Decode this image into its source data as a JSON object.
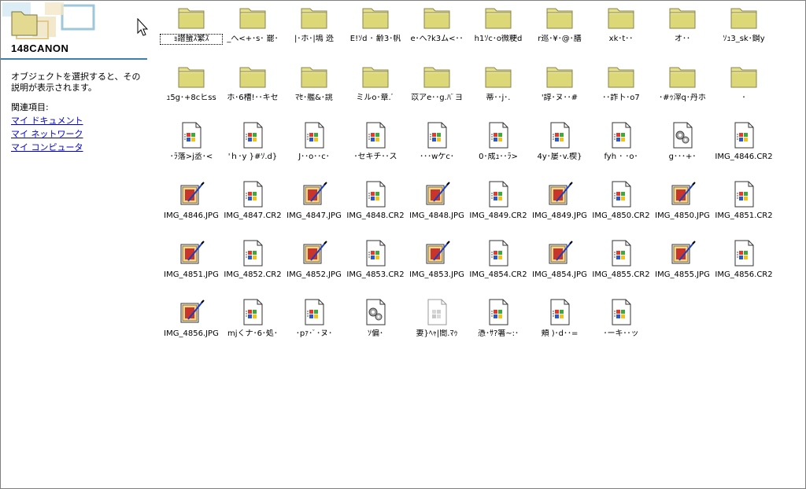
{
  "info_pane": {
    "folder_name": "148CANON",
    "description": "オブジェクトを選択すると、その説明が表示されます。",
    "related_heading": "関連項目:",
    "related_links": [
      "マイ ドキュメント",
      "マイ ネットワーク",
      "マイ コンピュータ"
    ]
  },
  "items": [
    {
      "label": "ｮ譛蜑ｽ繁ｽ",
      "icon": "folder-icon",
      "selected": true
    },
    {
      "label": "_へ<+･s･ 罷･",
      "icon": "folder-icon"
    },
    {
      "label": "|･ホ･|塢 迯",
      "icon": "folder-icon"
    },
    {
      "label": "E!ｿd ･ 齢3･帆",
      "icon": "folder-icon"
    },
    {
      "label": "e･へ?k3ム<･･",
      "icon": "folder-icon"
    },
    {
      "label": "h1ｿc･o微粳d",
      "icon": "folder-icon"
    },
    {
      "label": "r巡･¥･@･膳",
      "icon": "folder-icon"
    },
    {
      "label": "xk･t･･",
      "icon": "folder-icon"
    },
    {
      "label": "オ･･",
      "icon": "folder-icon"
    },
    {
      "label": "ｿｭ3_sk･鋼y",
      "icon": "folder-icon"
    },
    {
      "label": "ｭ5g･+8cヒss",
      "icon": "folder-icon"
    },
    {
      "label": "ホ･6槽!･･キセ",
      "icon": "folder-icon"
    },
    {
      "label": "ﾏｾ･艦&･誂",
      "icon": "folder-icon"
    },
    {
      "label": "ミルo･章.ﾟ",
      "icon": "folder-icon"
    },
    {
      "label": "苡アe･･g.ﾊﾞヨ",
      "icon": "folder-icon"
    },
    {
      "label": "蒂･･j･.",
      "icon": "folder-icon"
    },
    {
      "label": "'諄･ヌ･･#",
      "icon": "folder-icon"
    },
    {
      "label": "･･詐卜･o7",
      "icon": "folder-icon"
    },
    {
      "label": "･#ｩ滓q･丹ホ",
      "icon": "folder-icon"
    },
    {
      "label": "･",
      "icon": "folder-icon"
    },
    {
      "label": "･ﾗ落>j丞･<",
      "icon": "windows-file-icon"
    },
    {
      "label": "'ｈ･y }#ｿ.d}",
      "icon": "windows-file-icon"
    },
    {
      "label": "J･･o･･c･",
      "icon": "windows-file-icon"
    },
    {
      "label": "･セキチ･･ス",
      "icon": "windows-file-icon"
    },
    {
      "label": "･･･wケc･",
      "icon": "windows-file-icon"
    },
    {
      "label": "0･成ｭ･･ﾗ>",
      "icon": "windows-file-icon"
    },
    {
      "label": "4y･屡･v.楔}",
      "icon": "windows-file-icon"
    },
    {
      "label": "fyh ･ ･o･",
      "icon": "windows-file-icon"
    },
    {
      "label": "g･･･+･",
      "icon": "system-file-icon"
    },
    {
      "label": "IMG_4846.CR2",
      "icon": "windows-file-icon"
    },
    {
      "label": "IMG_4846.JPG",
      "icon": "paint-image-icon"
    },
    {
      "label": "IMG_4847.CR2",
      "icon": "windows-file-icon"
    },
    {
      "label": "IMG_4847.JPG",
      "icon": "paint-image-icon"
    },
    {
      "label": "IMG_4848.CR2",
      "icon": "windows-file-icon"
    },
    {
      "label": "IMG_4848.JPG",
      "icon": "paint-image-icon"
    },
    {
      "label": "IMG_4849.CR2",
      "icon": "windows-file-icon"
    },
    {
      "label": "IMG_4849.JPG",
      "icon": "paint-image-icon"
    },
    {
      "label": "IMG_4850.CR2",
      "icon": "windows-file-icon"
    },
    {
      "label": "IMG_4850.JPG",
      "icon": "paint-image-icon"
    },
    {
      "label": "IMG_4851.CR2",
      "icon": "windows-file-icon"
    },
    {
      "label": "IMG_4851.JPG",
      "icon": "paint-image-icon"
    },
    {
      "label": "IMG_4852.CR2",
      "icon": "windows-file-icon"
    },
    {
      "label": "IMG_4852.JPG",
      "icon": "paint-image-icon"
    },
    {
      "label": "IMG_4853.CR2",
      "icon": "windows-file-icon"
    },
    {
      "label": "IMG_4853.JPG",
      "icon": "paint-image-icon"
    },
    {
      "label": "IMG_4854.CR2",
      "icon": "windows-file-icon"
    },
    {
      "label": "IMG_4854.JPG",
      "icon": "paint-image-icon"
    },
    {
      "label": "IMG_4855.CR2",
      "icon": "windows-file-icon"
    },
    {
      "label": "IMG_4855.JPG",
      "icon": "paint-image-icon"
    },
    {
      "label": "IMG_4856.CR2",
      "icon": "windows-file-icon"
    },
    {
      "label": "IMG_4856.JPG",
      "icon": "paint-image-icon"
    },
    {
      "label": "mjくナ･6･処･",
      "icon": "windows-file-icon"
    },
    {
      "label": "･pｧ･ﾟ･ヌ･",
      "icon": "windows-file-icon"
    },
    {
      "label": "ｿ偏･",
      "icon": "system-file-icon"
    },
    {
      "label": "妻}ﾍｬ|閤.ﾏｩ",
      "icon": "generic-file-icon"
    },
    {
      "label": "憑･ｻ?箸~:･",
      "icon": "windows-file-icon"
    },
    {
      "label": "頬 )･d･･=",
      "icon": "windows-file-icon",
      "wrap": true
    },
    {
      "label": "･ーキ･･ッ",
      "icon": "windows-file-icon"
    }
  ]
}
